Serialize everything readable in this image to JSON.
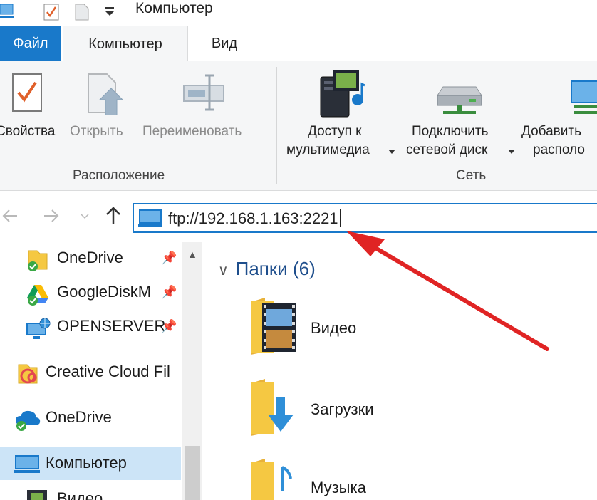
{
  "window": {
    "title": "Компьютер"
  },
  "ribbon_tabs": [
    {
      "label": "Файл"
    },
    {
      "label": "Компьютер"
    },
    {
      "label": "Вид"
    }
  ],
  "ribbon": {
    "location_group": {
      "label": "Расположение",
      "buttons": [
        {
          "label": "Свойства",
          "icon": "properties-icon"
        },
        {
          "label": "Открыть",
          "icon": "open-icon"
        },
        {
          "label": "Переименовать",
          "icon": "rename-icon"
        }
      ]
    },
    "network_group": {
      "label": "Сеть",
      "buttons": [
        {
          "line1": "Доступ к",
          "line2": "мультимедиа",
          "icon": "media-access-icon"
        },
        {
          "line1": "Подключить",
          "line2": "сетевой диск",
          "icon": "network-drive-icon"
        },
        {
          "line1": "Добавить",
          "line2": "располо",
          "icon": "add-location-icon"
        }
      ]
    }
  },
  "address_bar": {
    "value": "ftp://192.168.1.163:2221"
  },
  "sidebar": {
    "items": [
      {
        "label": "OneDrive",
        "pinned": true
      },
      {
        "label": "GoogleDiskM",
        "pinned": true
      },
      {
        "label": "OPENSERVER",
        "pinned": true
      },
      {
        "label": "Creative Cloud Fil"
      },
      {
        "label": "OneDrive"
      },
      {
        "label": "Компьютер",
        "selected": true
      },
      {
        "label": "Видео"
      }
    ]
  },
  "content": {
    "section": "Папки (6)",
    "folders": [
      {
        "label": "Видео"
      },
      {
        "label": "Загрузки"
      },
      {
        "label": "Музыка"
      }
    ]
  },
  "colors": {
    "accent": "#1979ca",
    "arrow": "#e02424",
    "selected": "#cce4f7"
  }
}
